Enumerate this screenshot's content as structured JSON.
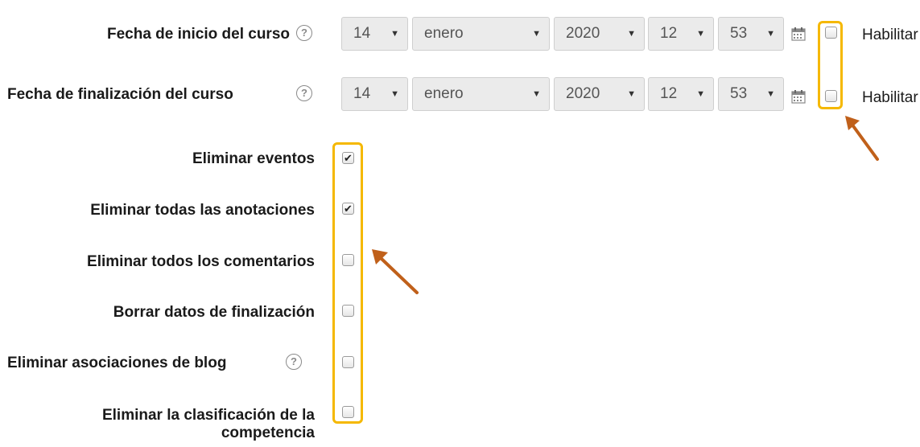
{
  "date_rows": [
    {
      "label": "Fecha de inicio del curso",
      "day": "14",
      "month": "enero",
      "year": "2020",
      "hour": "12",
      "minute": "53",
      "enable_label": "Habilitar",
      "enabled": false
    },
    {
      "label": "Fecha de finalización del curso",
      "day": "14",
      "month": "enero",
      "year": "2020",
      "hour": "12",
      "minute": "53",
      "enable_label": "Habilitar",
      "enabled": false
    }
  ],
  "options": [
    {
      "label": "Eliminar eventos",
      "checked": true,
      "help": false
    },
    {
      "label": "Eliminar todas las anotaciones",
      "checked": true,
      "help": false
    },
    {
      "label": "Eliminar todos los comentarios",
      "checked": false,
      "help": false
    },
    {
      "label": "Borrar datos de finalización",
      "checked": false,
      "help": false
    },
    {
      "label": "Eliminar asociaciones de blog",
      "checked": false,
      "help": true
    },
    {
      "label_line1": "Eliminar la clasificación de la",
      "label_line2": "competencia",
      "checked": false,
      "help": false
    }
  ],
  "icons": {
    "help": "question-circle-icon",
    "calendar": "calendar-icon",
    "dropdown": "caret-down-icon"
  },
  "colors": {
    "highlight": "#f5b800",
    "arrow": "#c0601a"
  }
}
